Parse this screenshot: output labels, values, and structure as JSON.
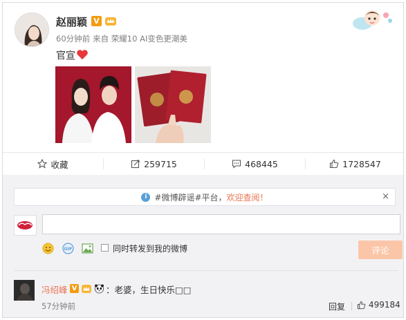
{
  "post": {
    "author": "赵丽颖",
    "verified_badge": "V",
    "time": "60分钟前",
    "source": "来自 荣耀10 AI变色更潮美",
    "text": "官宣"
  },
  "actions": {
    "favorite_label": "收藏",
    "repost_count": "259715",
    "comment_count": "468445",
    "like_count": "1728547"
  },
  "notice": {
    "prefix": "#微博辟谣#平台，",
    "link": "欢迎查阅！",
    "close": "×"
  },
  "composer": {
    "input_value": "",
    "repost_label": "同时转发到我的微博",
    "submit_label": "评论"
  },
  "comments": [
    {
      "name": "冯绍峰",
      "verified_badge": "V",
      "text": "：老婆，生日快乐□□",
      "time": "57分钟前",
      "reply_label": "回复",
      "like_count": "499184"
    }
  ],
  "colors": {
    "accent": "#eb7350",
    "verified": "#f39c12",
    "heart": "#e8383a",
    "submit_disabled": "#fbc6a8",
    "comment_bg": "#f2f2f5"
  },
  "icons": [
    "star-icon",
    "repost-icon",
    "comment-icon",
    "thumb-up-icon",
    "info-icon",
    "emoji-icon",
    "gif-icon",
    "image-icon",
    "heart-icon",
    "crown-icon",
    "panda-icon"
  ]
}
